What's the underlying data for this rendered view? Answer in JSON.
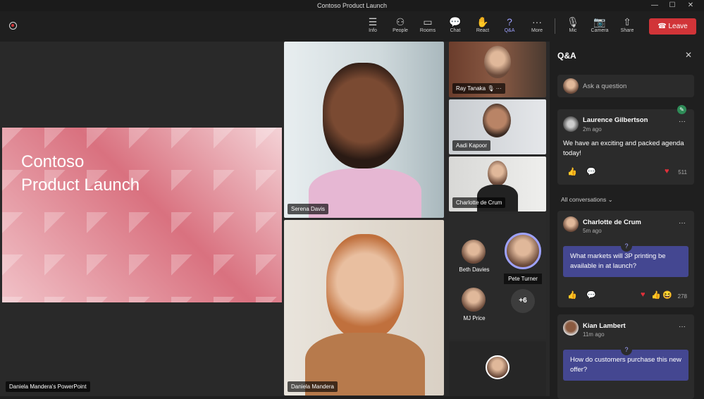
{
  "window": {
    "title": "Contoso Product Launch",
    "min": "—",
    "max": "☐",
    "close": "✕"
  },
  "toolbar": {
    "items": [
      {
        "label": "Info",
        "icon": "☰"
      },
      {
        "label": "People",
        "icon": "⚇"
      },
      {
        "label": "Rooms",
        "icon": "▭"
      },
      {
        "label": "Chat",
        "icon": "💬"
      },
      {
        "label": "React",
        "icon": "✋"
      },
      {
        "label": "Q&A",
        "icon": "?"
      },
      {
        "label": "More",
        "icon": "···"
      },
      {
        "label": "Mic",
        "icon": "🎙"
      },
      {
        "label": "Camera",
        "icon": "📷"
      },
      {
        "label": "Share",
        "icon": "⇧"
      }
    ],
    "leave": "Leave",
    "leave_color": "#d13438"
  },
  "stage": {
    "slide_title_1": "Contoso",
    "slide_title_2": "Product Launch",
    "presenter": "Daniela Mandera's PowerPoint"
  },
  "videos": {
    "serena": "Serena Davis",
    "daniela": "Daniela Mandera",
    "ray": "Ray Tanaka",
    "aadi": "Aadi Kapoor",
    "charlotte": "Charlotte de Crum"
  },
  "roster": {
    "beth": "Beth Davies",
    "pete": "Pete Turner",
    "mj": "MJ Price",
    "more": "+6"
  },
  "qa": {
    "title": "Q&A",
    "ask_placeholder": "Ask a question",
    "filter": "All conversations",
    "posts": [
      {
        "name": "Laurence Gilbertson",
        "time": "2m ago",
        "text": "We have an exciting and packed agenda today!",
        "count": "511"
      },
      {
        "name": "Charlotte de Crum",
        "time": "5m ago",
        "text": "What markets will 3P printing be available in at launch?",
        "count": "278"
      },
      {
        "name": "Kian Lambert",
        "time": "11m ago",
        "text": "How do customers purchase this new offer?"
      }
    ]
  }
}
